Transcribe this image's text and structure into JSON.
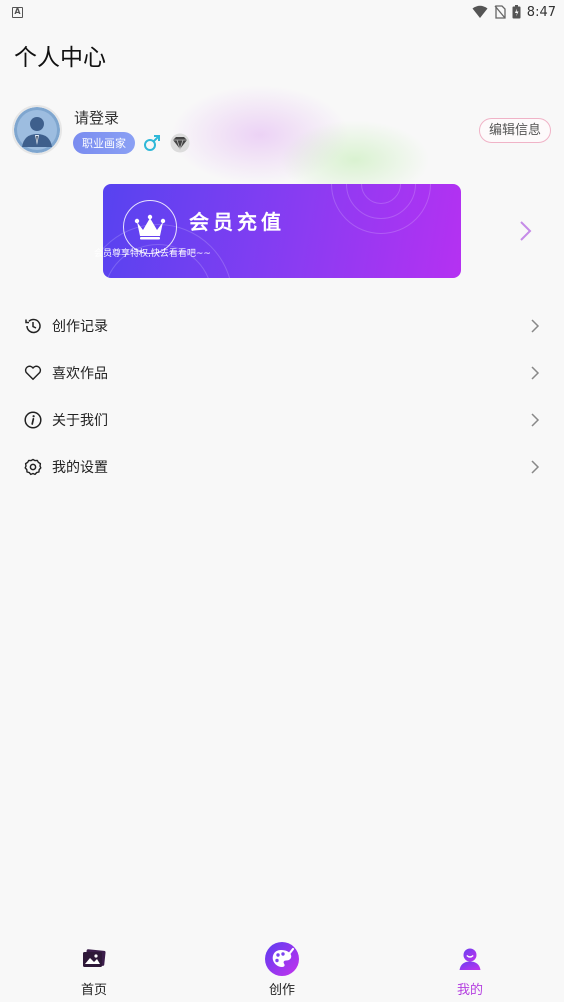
{
  "status_bar": {
    "time": "8:47"
  },
  "header": {
    "title": "个人中心"
  },
  "profile": {
    "username": "请登录",
    "job_badge": "职业画家",
    "edit_label": "编辑信息"
  },
  "vip_card": {
    "title": "会员充值",
    "subtitle": "会员尊享特权,快去看看吧~~"
  },
  "menu": {
    "items": [
      {
        "label": "创作记录",
        "icon": "history-icon"
      },
      {
        "label": "喜欢作品",
        "icon": "heart-icon"
      },
      {
        "label": "关于我们",
        "icon": "info-icon"
      },
      {
        "label": "我的设置",
        "icon": "gear-icon"
      }
    ]
  },
  "tabbar": {
    "tabs": [
      {
        "label": "首页",
        "icon": "gallery-icon"
      },
      {
        "label": "创作",
        "icon": "palette-icon"
      },
      {
        "label": "我的",
        "icon": "user-icon",
        "active": true
      }
    ]
  },
  "colors": {
    "accent": "#b43fe0",
    "vip_gradient_start": "#5743f0",
    "vip_gradient_end": "#b531f2",
    "badge": "#7a8cf0"
  }
}
